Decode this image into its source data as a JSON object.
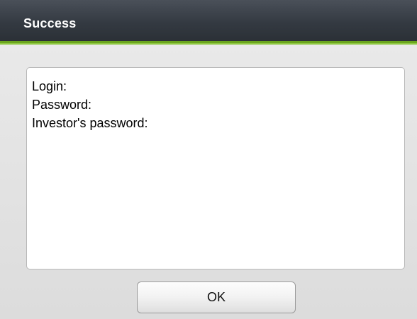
{
  "dialog": {
    "title": "Success",
    "info_lines": [
      "Login:",
      "Password:",
      "Investor's password:"
    ],
    "ok_label": "OK"
  },
  "colors": {
    "titlebar": "#343a42",
    "accent_stripe": "#6aa51e",
    "background": "#e6e6e6",
    "box": "#ffffff"
  }
}
